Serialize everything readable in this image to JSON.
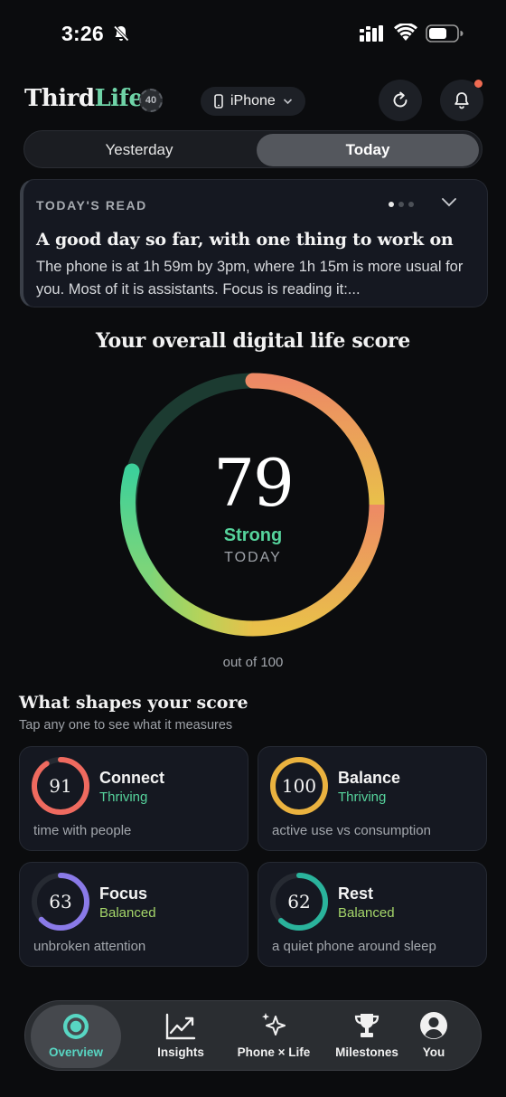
{
  "status_bar": {
    "time": "3:26"
  },
  "header": {
    "logo_part1": "Third",
    "logo_part2": "Life",
    "badge": "40",
    "device": "iPhone",
    "accent": "#6fd3a7",
    "notification_dot_color": "#ef6b52"
  },
  "segmented": {
    "yesterday": "Yesterday",
    "today": "Today",
    "selected": "Today"
  },
  "read_card": {
    "label": "TODAY'S READ",
    "title": "A good day so far, with one thing to work on",
    "body": "The phone is at 1h 59m by 3pm, where 1h 15m is more usual for you. Most of it is assistants. Focus is reading it:...",
    "page_index": 1,
    "page_count": 3
  },
  "score": {
    "title": "Your overall digital life score",
    "value": "79",
    "max": 100,
    "status": "Strong",
    "period": "TODAY",
    "out_of": "out of 100"
  },
  "shapes": {
    "title": "What shapes your score",
    "subtitle": "Tap any one to see what it measures",
    "metrics": [
      {
        "value": "91",
        "name": "Connect",
        "status": "Thriving",
        "desc": "time with people",
        "color": "#ef6a5f"
      },
      {
        "value": "100",
        "name": "Balance",
        "status": "Thriving",
        "desc": "active use vs consumption",
        "color": "#eab23f"
      },
      {
        "value": "63",
        "name": "Focus",
        "status": "Balanced",
        "desc": "unbroken attention",
        "color": "#8a7ae8"
      },
      {
        "value": "62",
        "name": "Rest",
        "status": "Balanced",
        "desc": "a quiet phone around sleep",
        "color": "#2ab39c"
      }
    ]
  },
  "tabbar": {
    "items": [
      "Overview",
      "Insights",
      "Phone × Life",
      "Milestones",
      "You"
    ],
    "active": "Overview",
    "active_color": "#58d6c3"
  }
}
